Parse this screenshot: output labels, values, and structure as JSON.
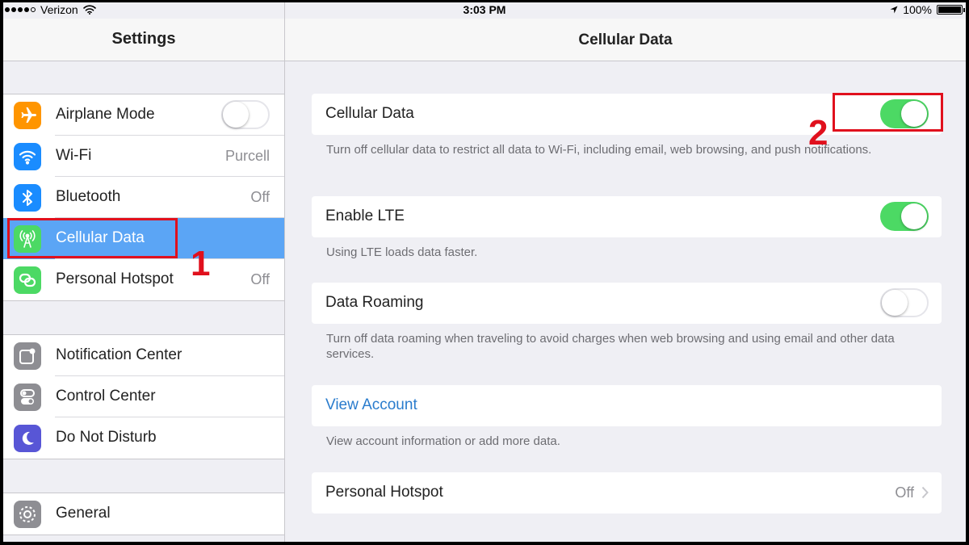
{
  "status_bar": {
    "carrier": "Verizon",
    "time": "3:03 PM",
    "battery": "100%",
    "battery_level": 1.0,
    "signal_bars_filled": 4,
    "icons": [
      "wifi-icon",
      "location-arrow-icon",
      "battery-icon"
    ]
  },
  "left": {
    "title": "Settings",
    "groups": [
      [
        {
          "label": "Airplane Mode",
          "icon": "airplane-icon",
          "color": "#ff9500",
          "toggle": false
        },
        {
          "label": "Wi-Fi",
          "icon": "wifi-icon",
          "color": "#1a8cff",
          "value": "Purcell"
        },
        {
          "label": "Bluetooth",
          "icon": "bluetooth-icon",
          "color": "#1a8cff",
          "value": "Off"
        },
        {
          "label": "Cellular Data",
          "icon": "cellular-antenna-icon",
          "color": "#4cd964",
          "selected": true
        },
        {
          "label": "Personal Hotspot",
          "icon": "hotspot-link-icon",
          "color": "#4cd964",
          "value": "Off"
        }
      ],
      [
        {
          "label": "Notification Center",
          "icon": "notification-icon",
          "color": "#8e8e93"
        },
        {
          "label": "Control Center",
          "icon": "control-switches-icon",
          "color": "#8e8e93"
        },
        {
          "label": "Do Not Disturb",
          "icon": "moon-icon",
          "color": "#5856d6"
        }
      ],
      [
        {
          "label": "General",
          "icon": "gear-icon",
          "color": "#8e8e93"
        }
      ]
    ]
  },
  "right": {
    "title": "Cellular Data",
    "cellular_data": {
      "label": "Cellular Data",
      "on": true,
      "footer": "Turn off cellular data to restrict all data to Wi-Fi, including email, web browsing, and push notifications."
    },
    "enable_lte": {
      "label": "Enable LTE",
      "on": true,
      "footer": "Using LTE loads data faster."
    },
    "data_roaming": {
      "label": "Data Roaming",
      "on": false,
      "footer": "Turn off data roaming when traveling to avoid charges when web browsing and using email and other data services."
    },
    "view_account": {
      "label": "View Account",
      "footer": "View account information or add more data."
    },
    "personal_hotspot": {
      "label": "Personal Hotspot",
      "value": "Off"
    }
  },
  "annotations": {
    "step1": "1",
    "step2": "2",
    "color": "#e0101d"
  },
  "colors": {
    "accent_blue": "#2a7ccd",
    "selected_row": "#5ba5f5",
    "toggle_on": "#4cd964"
  }
}
